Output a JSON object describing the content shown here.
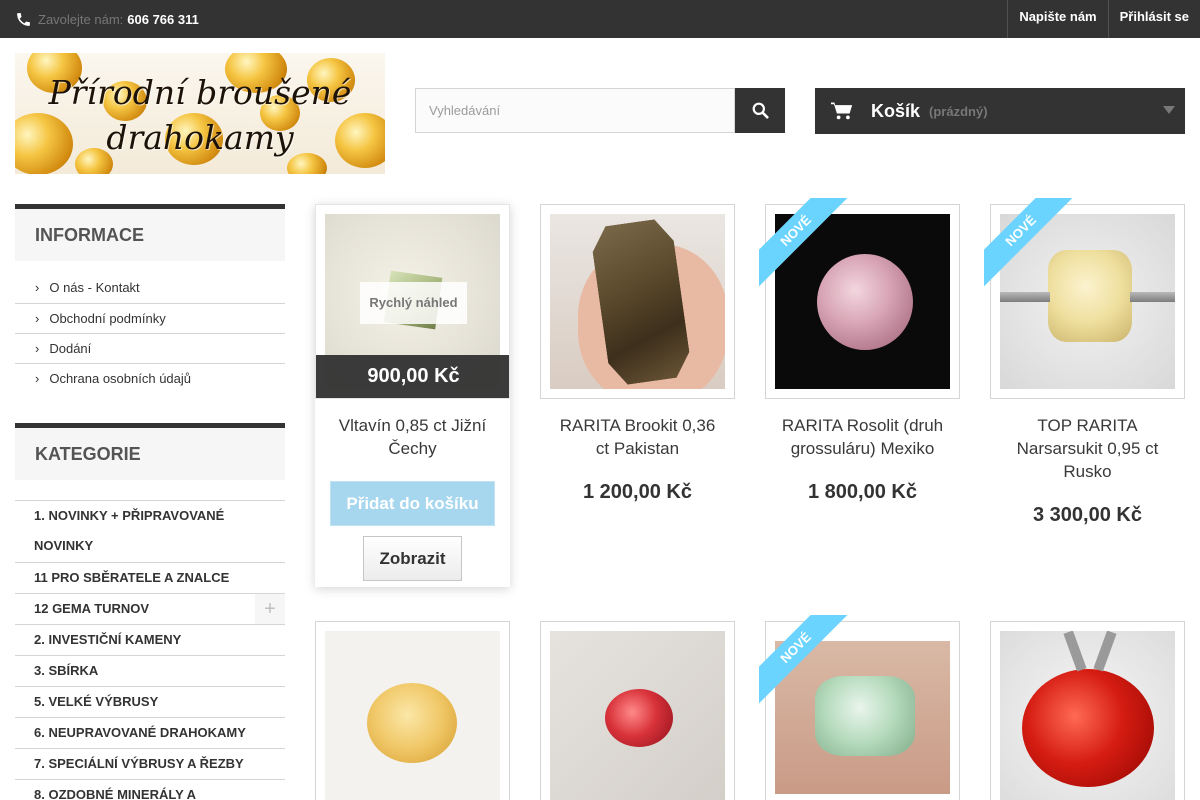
{
  "topbar": {
    "call_label": "Zavolejte nám:",
    "phone": "606 766 311",
    "links": [
      "Napište nám",
      "Přihlásit se"
    ]
  },
  "logo": {
    "line1": "Přírodní broušené",
    "line2": "drahokamy"
  },
  "search": {
    "placeholder": "Vyhledávání",
    "icon": "search-icon"
  },
  "cart": {
    "label": "Košík",
    "status": "(prázdný)",
    "icon": "cart-icon"
  },
  "sidebar": {
    "info_title": "INFORMACE",
    "info_items": [
      "O nás - Kontakt",
      "Obchodní podmínky",
      "Dodání",
      "Ochrana osobních údajů"
    ],
    "cat_title": "KATEGORIE",
    "categories": [
      "1. NOVINKY + PŘIPRAVOVANÉ NOVINKY",
      "11 PRO SBĚRATELE A ZNALCE",
      "12 GEMA TURNOV",
      "2. INVESTIČNÍ KAMENY",
      "3. SBÍRKA",
      "5. VELKÉ VÝBRUSY",
      "6. NEUPRAVOVANÉ DRAHOKAMY",
      "7. SPECIÁLNÍ VÝBRUSY A ŘEZBY",
      "8. OZDOBNÉ MINERÁLY A"
    ],
    "expand_symbol": "+"
  },
  "products": [
    {
      "name": "Vltavín 0,85 ct Jižní Čechy",
      "price": "900,00 Kč",
      "badge": "",
      "quick_view": "Rychlý náhled",
      "add_label": "Přidat do košíku",
      "view_label": "Zobrazit"
    },
    {
      "name": "RARITA Brookit 0,36 ct Pakistan",
      "price": "1 200,00 Kč",
      "badge": ""
    },
    {
      "name": "RARITA Rosolit (druh grossuláru) Mexiko",
      "price": "1 800,00 Kč",
      "badge": "Nové"
    },
    {
      "name": "TOP RARITA Narsarsukit 0,95 ct Rusko",
      "price": "3 300,00 Kč",
      "badge": "Nové"
    },
    {
      "name": "",
      "price": "",
      "badge": ""
    },
    {
      "name": "",
      "price": "",
      "badge": ""
    },
    {
      "name": "",
      "price": "",
      "badge": "Nové"
    },
    {
      "name": "",
      "price": "",
      "badge": ""
    }
  ],
  "colors": {
    "dark": "#333333",
    "badge": "#6ad4ff",
    "add_button": "#a7d7ee"
  }
}
